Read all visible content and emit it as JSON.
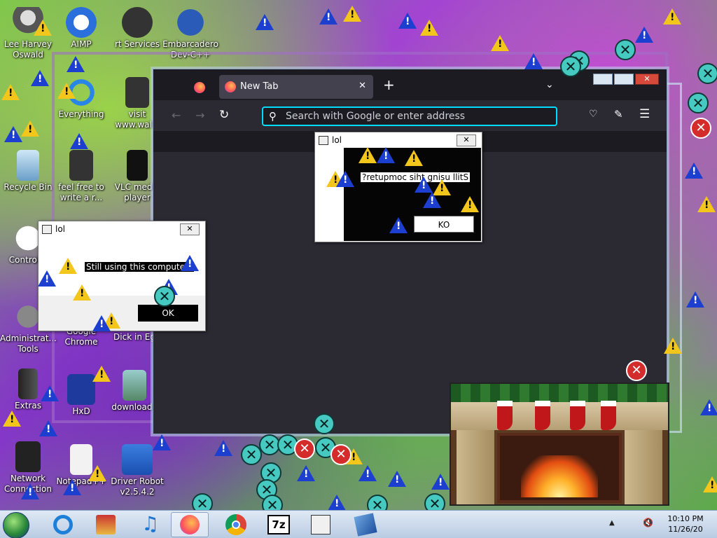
{
  "desktop": {
    "icons": [
      {
        "label": "Lee Harvey Oswald",
        "icon": "alien-icon"
      },
      {
        "label": "AIMP",
        "icon": "aimp-icon"
      },
      {
        "label": "rt Services",
        "icon": "services-icon"
      },
      {
        "label": "Embarcadero Dev-C++",
        "icon": "devcpp-icon"
      },
      {
        "label": "Everything",
        "icon": "search-icon"
      },
      {
        "label": "visit www.wallb",
        "icon": "document-icon"
      },
      {
        "label": "Recycle Bin",
        "icon": "recycle-bin-icon"
      },
      {
        "label": "feel free to write a r...",
        "icon": "document-icon"
      },
      {
        "label": "VLC media player",
        "icon": "vlc-icon"
      },
      {
        "label": "Control P",
        "icon": "control-panel-icon"
      },
      {
        "label": "Administrat... Tools",
        "icon": "admin-tools-icon"
      },
      {
        "label": "Google Chrome",
        "icon": "chrome-icon"
      },
      {
        "label": "Dick in Eg",
        "icon": "image-icon"
      },
      {
        "label": "Extras",
        "icon": "folder-icon"
      },
      {
        "label": "HxD",
        "icon": "hxd-icon"
      },
      {
        "label": "download.j",
        "icon": "image-icon"
      },
      {
        "label": "Network Connection",
        "icon": "network-icon"
      },
      {
        "label": "Notepad++",
        "icon": "notepad-icon"
      },
      {
        "label": "Driver Robot v2.5.4.2",
        "icon": "driver-robot-icon"
      }
    ]
  },
  "browser": {
    "tab_title": "New Tab",
    "tab_close": "✕",
    "new_tab": "+",
    "url_placeholder": "Search with Google or enter address",
    "accent": "#00ddff"
  },
  "dialog_left": {
    "title": "lol",
    "close": "✕",
    "message": "Still using this computer?",
    "ok_label": "OK"
  },
  "dialog_right": {
    "title": "lol",
    "close": "✕",
    "message": "?retupmoc siht gnisu llitS",
    "ok_label": "KO"
  },
  "taskbar": {
    "apps": [
      "start-orb-icon",
      "internet-explorer-icon",
      "gallery-icon",
      "music-icon",
      "firefox-icon",
      "chrome-icon",
      "7zip-icon",
      "app-window-icon",
      "virtualbox-icon"
    ],
    "sevenzip_label": "7z",
    "clock_time": "10:10 PM",
    "clock_date": "11/26/20"
  }
}
